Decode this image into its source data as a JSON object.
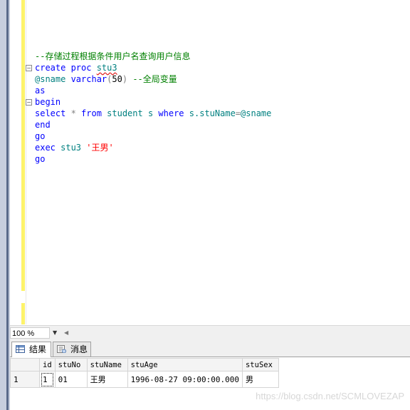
{
  "editor": {
    "lines": [
      {
        "fold": false,
        "tokens": [
          {
            "t": "cm",
            "v": "--存储过程根据条件用户名查询用户信息"
          }
        ]
      },
      {
        "fold": true,
        "tokens": [
          {
            "t": "kw",
            "v": "create proc "
          },
          {
            "t": "nm sq",
            "v": "stu3"
          }
        ]
      },
      {
        "fold": false,
        "tokens": [
          {
            "t": "nm",
            "v": "@sname "
          },
          {
            "t": "kw",
            "v": "varchar"
          },
          {
            "t": "op",
            "v": "("
          },
          {
            "t": "tx",
            "v": "50"
          },
          {
            "t": "op",
            "v": ")"
          },
          {
            "t": "tx",
            "v": " "
          },
          {
            "t": "cm",
            "v": "--全局变量"
          }
        ]
      },
      {
        "fold": false,
        "tokens": [
          {
            "t": "kw",
            "v": "as"
          }
        ]
      },
      {
        "fold": true,
        "tokens": [
          {
            "t": "kw",
            "v": "begin"
          }
        ]
      },
      {
        "fold": false,
        "tokens": [
          {
            "t": "kw",
            "v": "select "
          },
          {
            "t": "op",
            "v": "* "
          },
          {
            "t": "kw",
            "v": "from "
          },
          {
            "t": "nm",
            "v": "student s "
          },
          {
            "t": "kw",
            "v": "where "
          },
          {
            "t": "nm",
            "v": "s.stuName"
          },
          {
            "t": "op",
            "v": "="
          },
          {
            "t": "nm",
            "v": "@sname"
          }
        ]
      },
      {
        "fold": false,
        "tokens": [
          {
            "t": "kw",
            "v": "end"
          }
        ]
      },
      {
        "fold": false,
        "tokens": [
          {
            "t": "kw",
            "v": "go"
          }
        ]
      },
      {
        "fold": false,
        "tokens": [
          {
            "t": "kw",
            "v": "exec "
          },
          {
            "t": "nm",
            "v": "stu3 "
          },
          {
            "t": "st",
            "v": "'王男'"
          }
        ]
      },
      {
        "fold": false,
        "tokens": [
          {
            "t": "kw",
            "v": "go"
          }
        ]
      }
    ]
  },
  "zoom": {
    "value": "100 %"
  },
  "tabs": {
    "results": "结果",
    "messages": "消息"
  },
  "results": {
    "columns": [
      "id",
      "stuNo",
      "stuName",
      "stuAge",
      "stuSex"
    ],
    "rows": [
      {
        "row_number": "1",
        "cells": [
          "1",
          "01",
          "王男",
          "1996-08-27 09:00:00.000",
          "男"
        ]
      }
    ]
  },
  "watermark": "https://blog.csdn.net/SCMLOVEZAP",
  "colors": {
    "keyword": "#0000ff",
    "comment": "#008000",
    "identifier": "#008080",
    "string": "#ff0000",
    "change_bar": "#fdf36a"
  }
}
